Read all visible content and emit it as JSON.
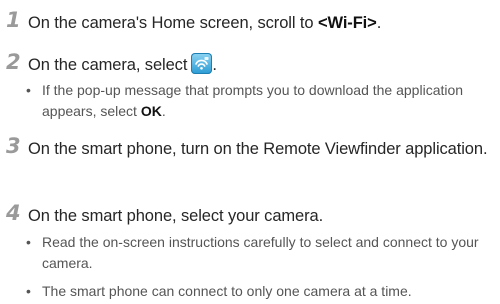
{
  "steps": [
    {
      "number": "1",
      "text_before": "On the camera's Home screen, scroll to ",
      "text_strong": "<Wi-Fi>",
      "text_after": "."
    },
    {
      "number": "2",
      "text_before": "On the camera, select",
      "text_after": ".",
      "icon": "wifi-remote-viewfinder-icon",
      "bullet_before": "If the pop-up message that prompts you to download the application appears, select ",
      "bullet_strong": "OK",
      "bullet_after": "."
    },
    {
      "number": "3",
      "text": "On the smart phone, turn on the Remote Viewfinder application."
    },
    {
      "number": "4",
      "text": "On the smart phone, select your camera.",
      "bullets": [
        "Read the on-screen instructions carefully to select and connect to your camera.",
        "The smart phone can connect to only one camera at a time."
      ]
    }
  ],
  "bullet_glyph": "•",
  "colors": {
    "step_number": "#9a9a9a",
    "body_text": "#262626",
    "bullet_text": "#555555",
    "icon_accent": "#2a9bd4"
  }
}
